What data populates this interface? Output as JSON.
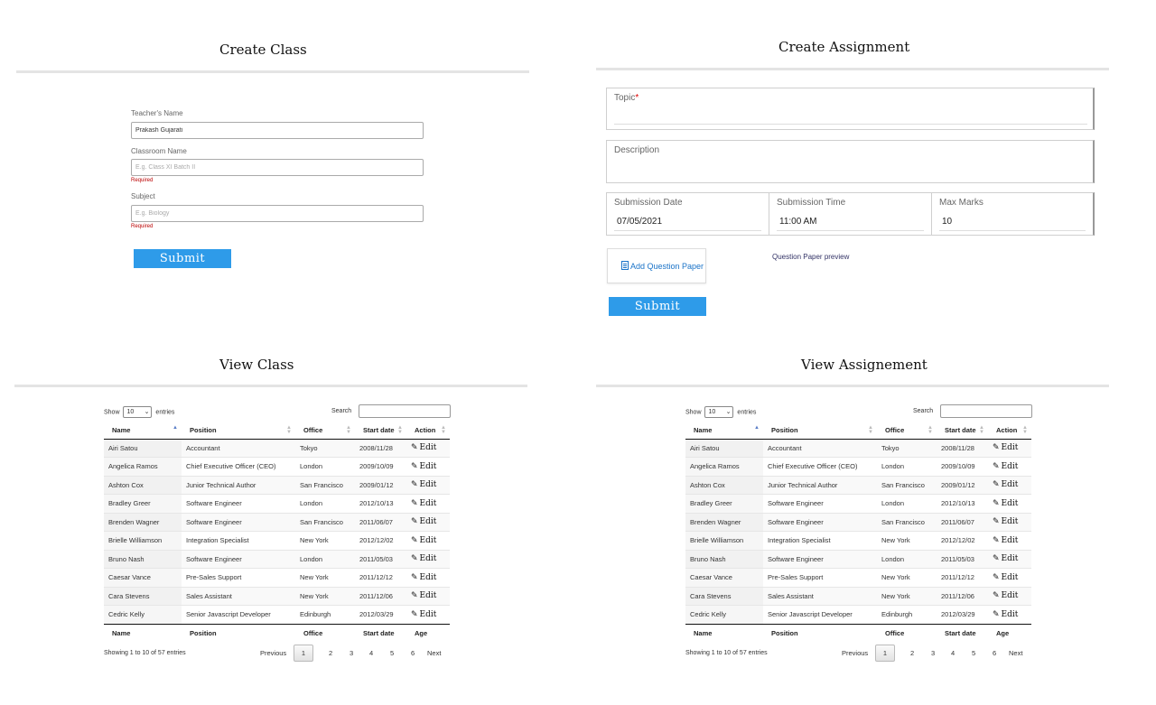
{
  "create_class": {
    "title": "Create Class",
    "teacher_label": "Teacher's Name",
    "teacher_value": "Prakash Gujarati",
    "classroom_label": "Classroom Name",
    "classroom_placeholder": "E.g. Class XI Batch II",
    "classroom_required": "Required",
    "subject_label": "Subject",
    "subject_placeholder": "E.g. Biology",
    "subject_required": "Required",
    "submit_label": "Submit"
  },
  "create_assignment": {
    "title": "Create Assignment",
    "topic_label": "Topic",
    "topic_required_mark": "*",
    "description_label": "Description",
    "submission_date_label": "Submission Date",
    "submission_date_value": "07/05/2021",
    "submission_time_label": "Submission Time",
    "submission_time_value": "11:00 AM",
    "max_marks_label": "Max Marks",
    "max_marks_value": "10",
    "add_question_paper_label": "Add Question Paper",
    "question_paper_preview": "Question Paper preview",
    "submit_label": "Submit"
  },
  "view_class": {
    "title": "View Class"
  },
  "view_assignment": {
    "title": "View Assignement"
  },
  "table": {
    "show_label": "Show",
    "entries_value": "10",
    "entries_label": "entries",
    "search_label": "Search",
    "columns": [
      "Name",
      "Position",
      "Office",
      "Start date",
      "Action"
    ],
    "footer_columns": [
      "Name",
      "Position",
      "Office",
      "Start date",
      "Age"
    ],
    "edit_label": "Edit",
    "rows": [
      [
        "Airi Satou",
        "Accountant",
        "Tokyo",
        "2008/11/28"
      ],
      [
        "Angelica Ramos",
        "Chief Executive Officer (CEO)",
        "London",
        "2009/10/09"
      ],
      [
        "Ashton Cox",
        "Junior Technical Author",
        "San Francisco",
        "2009/01/12"
      ],
      [
        "Bradley Greer",
        "Software Engineer",
        "London",
        "2012/10/13"
      ],
      [
        "Brenden Wagner",
        "Software Engineer",
        "San Francisco",
        "2011/06/07"
      ],
      [
        "Brielle Williamson",
        "Integration Specialist",
        "New York",
        "2012/12/02"
      ],
      [
        "Bruno Nash",
        "Software Engineer",
        "London",
        "2011/05/03"
      ],
      [
        "Caesar Vance",
        "Pre-Sales Support",
        "New York",
        "2011/12/12"
      ],
      [
        "Cara Stevens",
        "Sales Assistant",
        "New York",
        "2011/12/06"
      ],
      [
        "Cedric Kelly",
        "Senior Javascript Developer",
        "Edinburgh",
        "2012/03/29"
      ]
    ],
    "info": "Showing 1 to 10 of 57 entries",
    "pagination": {
      "previous": "Previous",
      "pages": [
        "1",
        "2",
        "3",
        "4",
        "5",
        "6"
      ],
      "current": "1",
      "next": "Next"
    }
  }
}
